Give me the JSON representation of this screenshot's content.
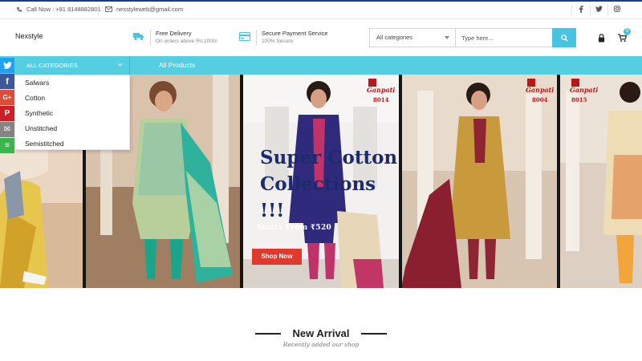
{
  "topbar": {
    "phone": "Call Now : +91 8148882801",
    "email": "nexstyleweb@gmail.com",
    "social": [
      "facebook-icon",
      "twitter-icon",
      "instagram-icon"
    ]
  },
  "header": {
    "brand": "Nexstyle",
    "features": [
      {
        "icon": "truck-icon",
        "title": "Free Delivery",
        "subtitle": "On orders above Rs.1000/-"
      },
      {
        "icon": "card-icon",
        "title": "Secure Payment Service",
        "subtitle": "100% Secure"
      }
    ],
    "search": {
      "category": "All categories",
      "placeholder": "Type here..."
    },
    "cart_count": "0"
  },
  "nav": {
    "all_categories": "ALL CATEGORIES",
    "all_products": "All Products",
    "categories": [
      "Salwars",
      "Cotton",
      "Synthetic",
      "Unstitched",
      "Semistitched"
    ]
  },
  "share_rail": [
    {
      "name": "twitter",
      "color": "#1da1f2",
      "glyph": "t"
    },
    {
      "name": "facebook",
      "color": "#3b5998",
      "glyph": "f"
    },
    {
      "name": "google-plus",
      "color": "#dd4b39",
      "glyph": "G+"
    },
    {
      "name": "pinterest",
      "color": "#cb2027",
      "glyph": "P"
    },
    {
      "name": "email",
      "color": "#848484",
      "glyph": "✉"
    },
    {
      "name": "more",
      "color": "#3ab54a",
      "glyph": "≡"
    }
  ],
  "banner": {
    "headline_line1": "Super Cotton",
    "headline_line2": "Collections !!!",
    "starts_from": "Starts From ₹520",
    "cta": "Shop Now",
    "brand_logo": "Ganpati",
    "codes": [
      "8014",
      "8004",
      "8015"
    ]
  },
  "section": {
    "title": "New Arrival",
    "subtitle": "Recently added our shop"
  },
  "colors": {
    "accent": "#55cee2",
    "headline": "#1d2a6d",
    "cta": "#e03a2e"
  }
}
